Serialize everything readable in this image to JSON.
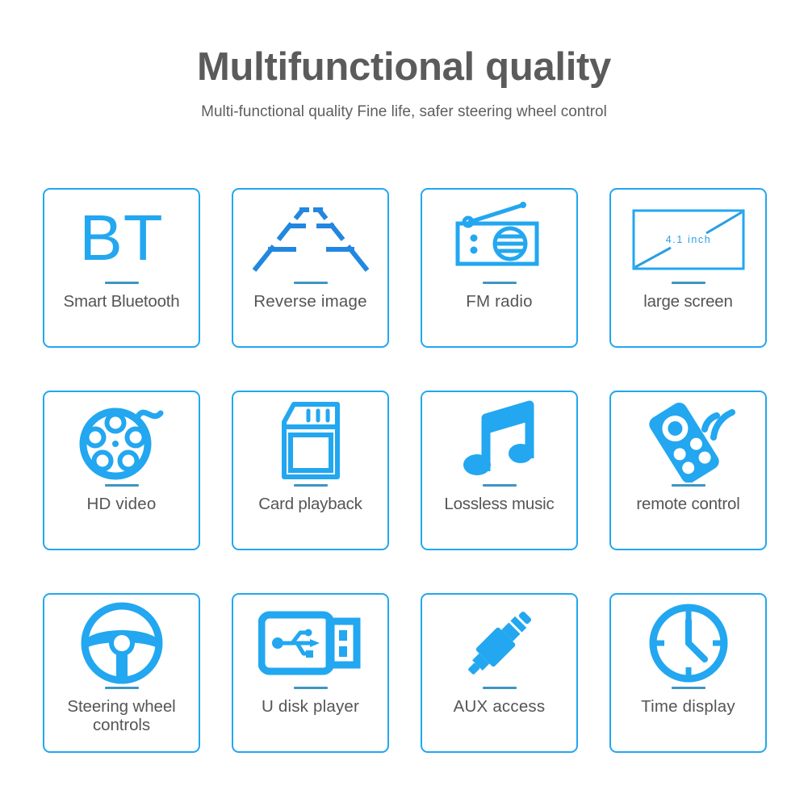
{
  "header": {
    "title": "Multifunctional quality",
    "subtitle": "Multi-functional quality Fine life, safer steering wheel control"
  },
  "colors": {
    "accent_blue": "#22a7f0",
    "divider_blue": "#3e95c4",
    "title_gray": "#5b5b5b",
    "label_gray": "#555555",
    "background": "#ffffff"
  },
  "features": [
    {
      "label": "Smart Bluetooth",
      "icon": "bluetooth-bt-icon",
      "badge_text": "BT"
    },
    {
      "label": "Reverse image",
      "icon": "reverse-parking-lines-icon"
    },
    {
      "label": "FM radio",
      "icon": "radio-icon"
    },
    {
      "label": "large screen",
      "icon": "screen-icon",
      "screen_size": "4.1 inch"
    },
    {
      "label": "HD video",
      "icon": "film-reel-icon"
    },
    {
      "label": "Card playback",
      "icon": "sd-card-icon"
    },
    {
      "label": "Lossless music",
      "icon": "music-note-icon"
    },
    {
      "label": "remote control",
      "icon": "remote-control-icon"
    },
    {
      "label": "Steering wheel controls",
      "icon": "steering-wheel-icon"
    },
    {
      "label": "U disk player",
      "icon": "usb-flash-drive-icon"
    },
    {
      "label": "AUX access",
      "icon": "audio-jack-icon"
    },
    {
      "label": "Time display",
      "icon": "clock-icon"
    }
  ]
}
